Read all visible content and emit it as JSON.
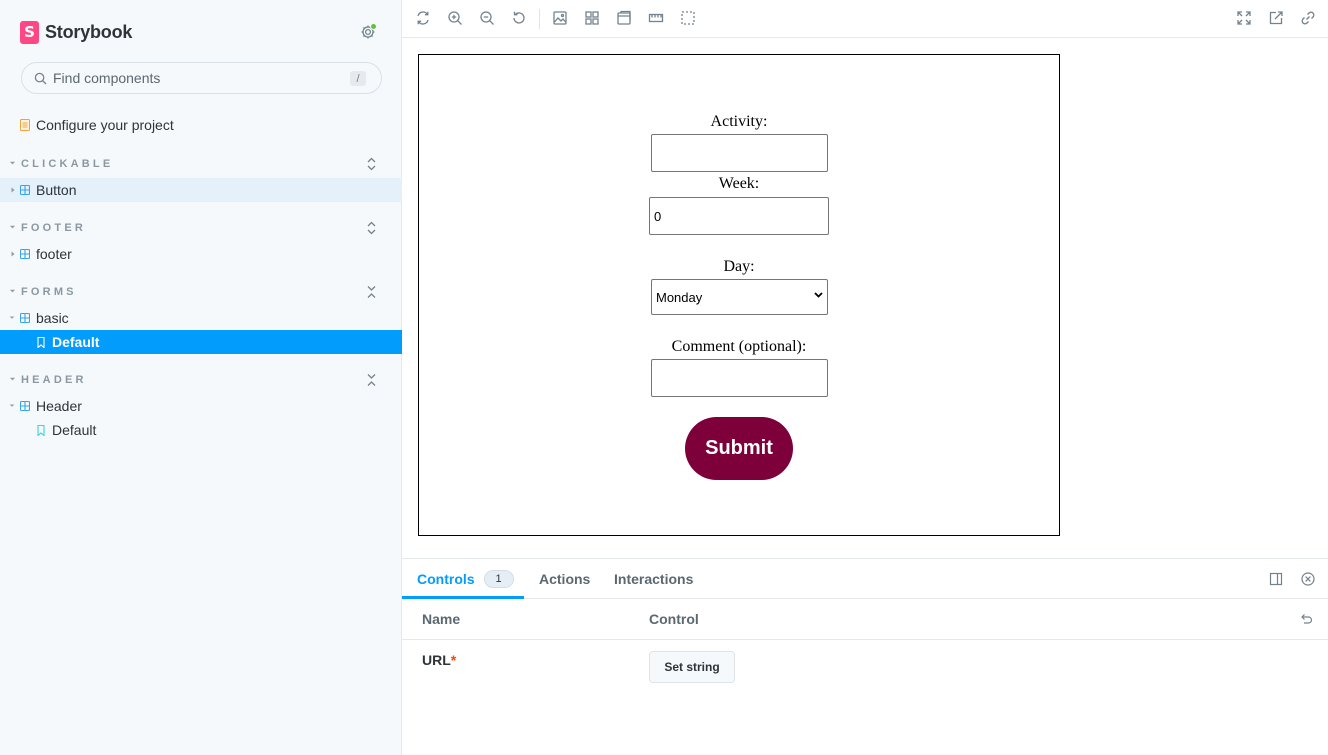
{
  "brand": {
    "name": "Storybook",
    "logo_letter": "S"
  },
  "search": {
    "placeholder": "Find components",
    "shortcut": "/"
  },
  "sidebar": {
    "configure_label": "Configure your project",
    "groups": [
      {
        "label": "CLICKABLE",
        "toggle": "expand",
        "items": [
          {
            "label": "Button",
            "type": "component",
            "expanded": false
          }
        ]
      },
      {
        "label": "FOOTER",
        "toggle": "expand",
        "items": [
          {
            "label": "footer",
            "type": "component",
            "expanded": false
          }
        ]
      },
      {
        "label": "FORMS",
        "toggle": "collapse",
        "items": [
          {
            "label": "basic",
            "type": "component",
            "expanded": true
          },
          {
            "label": "Default",
            "type": "story",
            "selected": true
          }
        ]
      },
      {
        "label": "HEADER",
        "toggle": "collapse",
        "items": [
          {
            "label": "Header",
            "type": "component",
            "expanded": true
          },
          {
            "label": "Default",
            "type": "story",
            "selected": false
          }
        ]
      }
    ]
  },
  "toolbar": {
    "icons": [
      "remount-icon",
      "zoom-in-icon",
      "zoom-out-icon",
      "reset-zoom-icon",
      "background-icon",
      "grid-icon",
      "viewport-icon",
      "measure-icon",
      "outline-icon",
      "fullscreen-icon",
      "open-new-tab-icon",
      "copy-link-icon"
    ]
  },
  "form": {
    "activity_label": "Activity:",
    "activity_value": "",
    "week_label": "Week:",
    "week_value": "0",
    "day_label": "Day:",
    "day_value": "Monday",
    "comment_label": "Comment (optional):",
    "comment_value": "",
    "submit_label": "Submit"
  },
  "panel": {
    "tabs": [
      {
        "label": "Controls",
        "badge": "1",
        "active": true
      },
      {
        "label": "Actions",
        "active": false
      },
      {
        "label": "Interactions",
        "active": false
      }
    ],
    "columns": {
      "name": "Name",
      "control": "Control"
    },
    "rows": [
      {
        "name": "URL",
        "required": "*",
        "control_label": "Set string"
      }
    ]
  },
  "colors": {
    "accent": "#029cfd",
    "brand_pink": "#ff4785",
    "submit_bg": "#7d003b",
    "status_dot": "#66bf3c",
    "required": "#ff4400"
  }
}
